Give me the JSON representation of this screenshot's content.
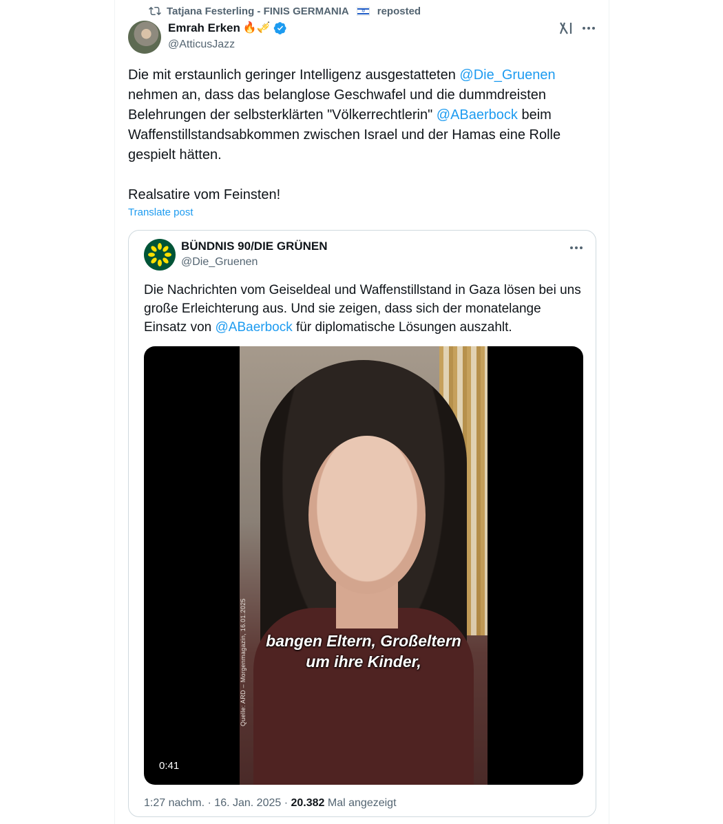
{
  "repost": {
    "text": "Tatjana Festerling - FINIS GERMANIA",
    "suffix": "reposted"
  },
  "author": {
    "name": "Emrah Erken",
    "emojis": "🔥🎺",
    "handle": "@AtticusJazz"
  },
  "post": {
    "lines": [
      "Die mit erstaunlich geringer Intelligenz ausgestatteten ",
      "@Die_Gruenen",
      " nehmen an, dass das belanglose Geschwafel und die dummdreisten Belehrungen der selbsterklärten \"Völkerrechtlerin\" ",
      "@ABaerbock",
      " beim Waffenstillstandsabkommen zwischen Israel und der Hamas eine Rolle gespielt hätten."
    ],
    "closing": "Realsatire vom Feinsten!",
    "translate_label": "Translate post"
  },
  "quote": {
    "name": "BÜNDNIS 90/DIE GRÜNEN",
    "handle": "@Die_Gruenen",
    "text_before": "Die Nachrichten vom Geiseldeal und Waffenstillstand in Gaza lösen bei uns große Erleichterung aus. Und sie zeigen, dass sich der monatelange Einsatz von ",
    "mention": "@ABaerbock",
    "text_after": " für diplomatische Lösungen auszahlt.",
    "video": {
      "source_label": "Quelle: ARD – Morgenmagazin, 16.01.2025",
      "subtitle_line1": "bangen Eltern, Großeltern",
      "subtitle_line2": "um ihre Kinder,",
      "duration": "0:41"
    },
    "meta": {
      "time": "1:27 nachm.",
      "date": "16. Jan. 2025",
      "views": "20.382",
      "views_label": "Mal angezeigt"
    }
  },
  "colors": {
    "accent": "#1d9bf0",
    "muted": "#536471",
    "text": "#0f1419",
    "green": "#005437"
  },
  "icons": [
    "repost-icon",
    "verified-icon",
    "grok-icon",
    "more-icon",
    "sunflower-icon"
  ]
}
